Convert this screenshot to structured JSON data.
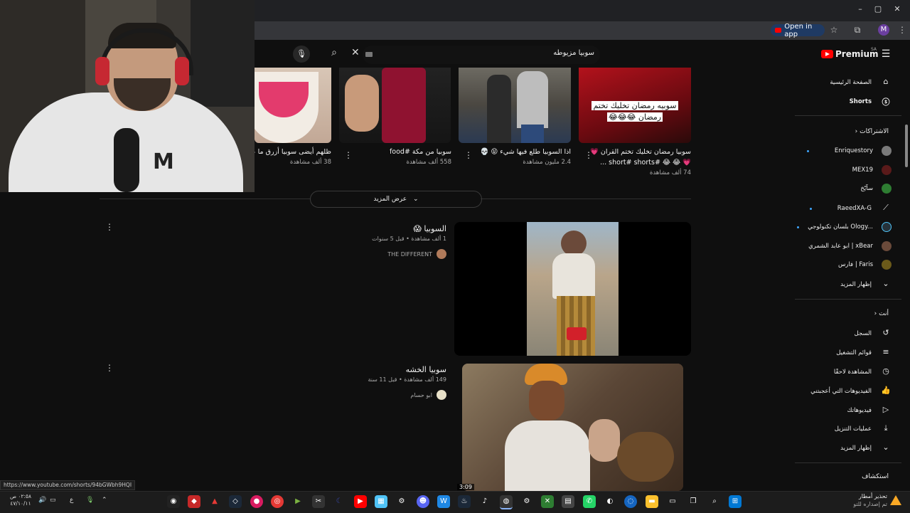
{
  "browser": {
    "open_in_app": "Open in app",
    "profile_initial": "M",
    "window_controls": [
      "–",
      "▢",
      "✕"
    ]
  },
  "header": {
    "search_query": "سوبيا مزيوطه",
    "logo_text": "Premium",
    "logo_sup": "SA"
  },
  "shorts": [
    {
      "title_l1": "سوبيا رمضان تخليك تختم القران 💗",
      "title_l2": "💗 😂 😂 #short# shorts ...",
      "views": "74 ألف مشاهدة",
      "overlay_l1": "سوبيه رمضان تخليك تختم",
      "overlay_l2": "رمضان 😂😂😂"
    },
    {
      "title_l1": "اذا السوبيا طلع فيها شيء 😝 💀",
      "title_l2": "",
      "views": "2.4 مليون مشاهدة"
    },
    {
      "title_l1": "سوبيا من مكة #food",
      "title_l2": "",
      "views": "558 ألف مشاهدة"
    },
    {
      "title_l1": "ظلهم أيضى سوبيا أزرق ما عندهم",
      "title_l2": "",
      "views": "38 ألف مشاهدة"
    }
  ],
  "show_more": "عرض المزيد",
  "results": [
    {
      "title": "السوبيا 😱",
      "meta": "1 ألف مشاهدة • قبل 5 سنوات",
      "channel": "THE DIFFERENT"
    },
    {
      "title": "سوبيا الخشه",
      "meta": "149 ألف مشاهدة • قبل 11 سنة",
      "channel": "ابو حسام",
      "duration": "3:09"
    }
  ],
  "sidebar": {
    "home": "الصفحة الرئيسية",
    "shorts": "Shorts",
    "subs_header": "الاشتراكات",
    "subscriptions": [
      {
        "name": "Enriquestory",
        "color": "#7a7a7a",
        "dot": true
      },
      {
        "name": "MEX19",
        "color": "#5a1a1a",
        "dot": false
      },
      {
        "name": "سآيّخ",
        "color": "#2e7d32",
        "dot": false
      },
      {
        "name": "RaeedXA-G",
        "color": "#333333",
        "dot": true
      },
      {
        "name": "بلسان تكنولوجي Ology...",
        "color": "#26323a",
        "dot": true
      },
      {
        "name": "ابو عابد الشمري | xBear",
        "color": "#6a4a3a",
        "dot": false
      },
      {
        "name": "فارس | Faris",
        "color": "#6b5a1a",
        "dot": false
      }
    ],
    "show_more": "إظهار المزيد",
    "you_header": "أنت",
    "you": [
      {
        "label": "السجل",
        "icon": "history-icon",
        "glyph": "↺"
      },
      {
        "label": "قوائم التشغيل",
        "icon": "playlists-icon",
        "glyph": "≡"
      },
      {
        "label": "المشاهدة لاحقًا",
        "icon": "watch-later-icon",
        "glyph": "◷"
      },
      {
        "label": "الفيديوهات التي أعجبتني",
        "icon": "like-icon",
        "glyph": "👍"
      },
      {
        "label": "فيديوهاتك",
        "icon": "your-videos-icon",
        "glyph": "▷"
      },
      {
        "label": "عمليات التنزيل",
        "icon": "download-icon",
        "glyph": "⤓"
      },
      {
        "label": "إظهار المزيد",
        "icon": "chevron-down-icon",
        "glyph": "⌄"
      }
    ],
    "explore_header": "استكشاف"
  },
  "status_url": "https://www.youtube.com/shorts/94bGWbh9HQI",
  "taskbar": {
    "time": "٠٢:٥٨ ص",
    "date": "٤٧/١٠/١١",
    "lang": "ع",
    "notif_title": "تحذير أمطار",
    "notif_sub": "تم إصداره للتو"
  }
}
